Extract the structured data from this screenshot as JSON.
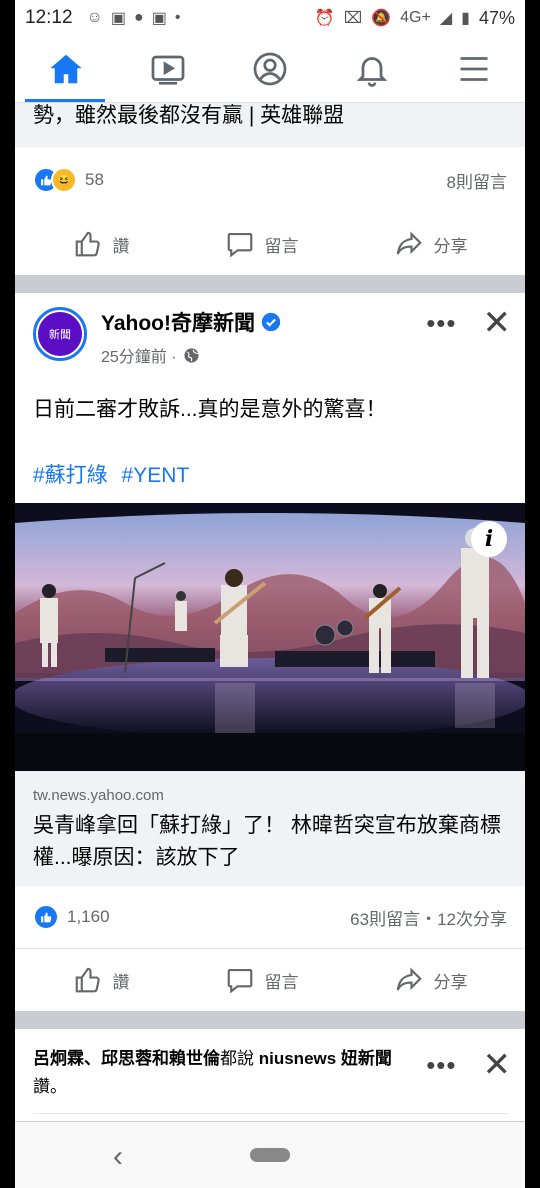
{
  "status_bar": {
    "time": "12:12",
    "network": "4G+",
    "battery": "47%"
  },
  "nav": {
    "tabs": [
      "home",
      "watch",
      "profile",
      "notifications",
      "menu"
    ],
    "active_color": "#1877f2"
  },
  "prev_post": {
    "link_title_tail": "勢，雖然最後都沒有贏 | 英雄聯盟",
    "reaction_count": "58",
    "comments": "8則留言"
  },
  "actions": {
    "like": "讚",
    "comment": "留言",
    "share": "分享"
  },
  "post": {
    "author": "Yahoo!奇摩新聞",
    "avatar_text": "新聞",
    "time": "25分鐘前 ·",
    "text": "日前二審才敗訴...真的是意外的驚喜！",
    "hashtags": [
      "#蘇打綠",
      "#YENT"
    ],
    "link_domain": "tw.news.yahoo.com",
    "link_title": "吳青峰拿回「蘇打綠」了！ 林暐哲突宣布放棄商標權...曝原因：該放下了",
    "reaction_count": "1,160",
    "stats": "63則留言・12次分享"
  },
  "next_post": {
    "friend_names": "呂炯霖、邱思蓉和賴世倫",
    "says": "都說",
    "page_name": "niusnews 妞新聞",
    "verb": "讚。"
  }
}
